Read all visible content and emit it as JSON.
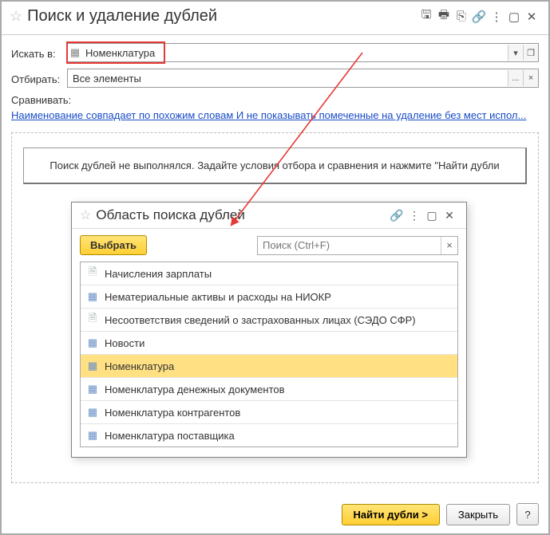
{
  "title": "Поиск и удаление дублей",
  "labels": {
    "search_in": "Искать в:",
    "filter": "Отбирать:",
    "compare": "Сравнивать:"
  },
  "fields": {
    "search_in_value": "Номенклатура",
    "filter_value": "Все элементы"
  },
  "compare_link": "Наименование совпадает по похожим словам И не показывать помеченные на удаление без мест испол...",
  "info_text": "Поиск дублей не выполнялся.   Задайте условия отбора и сравнения и нажмите \"Найти дубли",
  "popup": {
    "title": "Область поиска дублей",
    "select_btn": "Выбрать",
    "search_placeholder": "Поиск (Ctrl+F)",
    "items": [
      {
        "icon": "doc",
        "label": "Начисления зарплаты"
      },
      {
        "icon": "tbl",
        "label": "Нематериальные активы и расходы на НИОКР"
      },
      {
        "icon": "doc",
        "label": "Несоответствия сведений о застрахованных лицах (СЭДО СФР)"
      },
      {
        "icon": "tbl",
        "label": "Новости"
      },
      {
        "icon": "tbl",
        "label": "Номенклатура",
        "selected": true
      },
      {
        "icon": "tbl",
        "label": "Номенклатура денежных документов"
      },
      {
        "icon": "tbl",
        "label": "Номенклатура контрагентов"
      },
      {
        "icon": "tbl",
        "label": "Номенклатура поставщика"
      }
    ]
  },
  "buttons": {
    "find": "Найти дубли >",
    "close": "Закрыть",
    "help": "?"
  },
  "icons": {
    "save": "🖫",
    "print": "🖶",
    "preview": "⎘",
    "link": "🔗",
    "more": "⋮",
    "max": "▢",
    "close": "✕",
    "table": "▦",
    "doc": "🗎",
    "dots": "...",
    "open": "❐",
    "clear": "×",
    "chain": "🔗"
  }
}
